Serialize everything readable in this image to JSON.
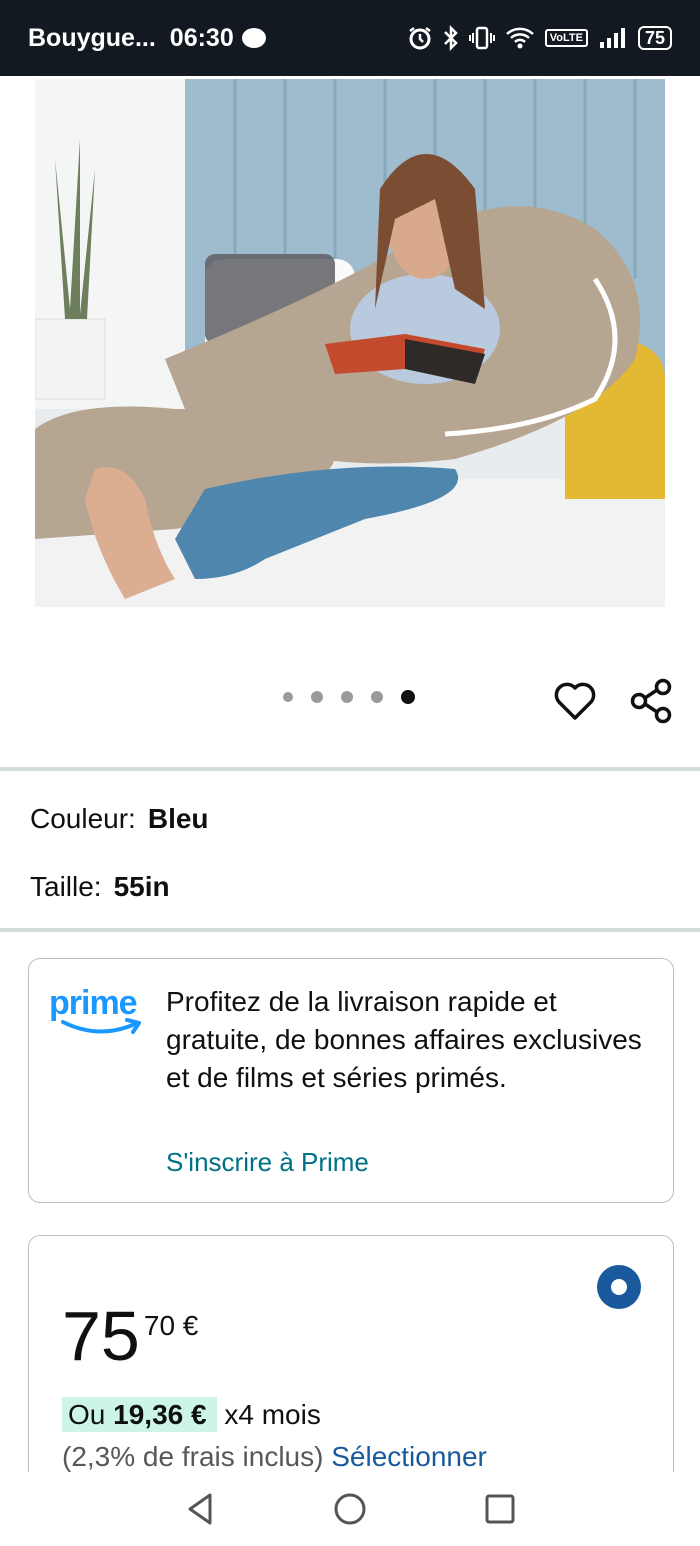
{
  "status_bar": {
    "carrier": "Bouygue...",
    "time": "06:30",
    "volte": "VoLTE",
    "battery": "75",
    "icons": [
      "message-bubble-icon",
      "alarm-icon",
      "bluetooth-icon",
      "vibrate-icon",
      "wifi-icon",
      "signal-icon",
      "battery-icon"
    ]
  },
  "product": {
    "image_icon": "product-photo",
    "carousel": {
      "total": 5,
      "active_index": 4
    }
  },
  "actions": {
    "wishlist_icon": "heart-icon",
    "share_icon": "share-icon"
  },
  "variations": {
    "color_label": "Couleur:",
    "color_value": "Bleu",
    "size_label": "Taille:",
    "size_value": "55in"
  },
  "prime": {
    "logo_text": "prime",
    "description": "Profitez de la livraison rapide et gratuite, de bonnes affaires exclusives et de films et séries primés.",
    "link": "S'inscrire à Prime",
    "colors": {
      "logo": "#1a98ff",
      "link": "#007185"
    }
  },
  "price": {
    "whole": "75",
    "fraction": "70 €",
    "installment_prefix": "Ou",
    "installment_amount": "19,36 €",
    "installment_suffix": "x4 mois",
    "fees_text": "(2,3% de frais inclus)",
    "select_link": "Sélectionner",
    "colors": {
      "highlight": "#ccf5e8",
      "link": "#1a5a9c"
    }
  },
  "nav_bar": {
    "icons": [
      "back-icon",
      "home-icon",
      "recents-icon"
    ]
  }
}
